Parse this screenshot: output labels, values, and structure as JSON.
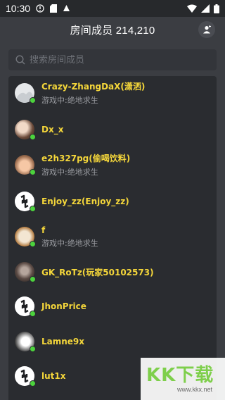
{
  "status_bar": {
    "time": "10:30",
    "icons_left": [
      "alert-icon",
      "sd-card-icon",
      "notification-icon"
    ],
    "icons_right": [
      "wifi-icon",
      "signal-icon",
      "battery-icon"
    ]
  },
  "header": {
    "title": "房间成员 214,210",
    "action_icon": "user-icon"
  },
  "search": {
    "placeholder": "搜索房间成员",
    "value": ""
  },
  "members": [
    {
      "name": "Crazy-ZhangDaX(潇洒)",
      "status": "游戏中:绝地求生",
      "avatar": "white",
      "online": true
    },
    {
      "name": "Dx_x",
      "status": "",
      "avatar": "warm",
      "online": true
    },
    {
      "name": "e2h327pg(偷喝饮料)",
      "status": "游戏中:绝地求生",
      "avatar": "peach",
      "online": true
    },
    {
      "name": "Enjoy_zz(Enjoy_zz)",
      "status": "",
      "avatar": "logo",
      "online": true
    },
    {
      "name": "f",
      "status": "游戏中:绝地求生",
      "avatar": "sepia",
      "online": true
    },
    {
      "name": "GK_RoTz(玩家50102573)",
      "status": "",
      "avatar": "dark",
      "online": true
    },
    {
      "name": "JhonPrice",
      "status": "",
      "avatar": "logo",
      "online": true
    },
    {
      "name": "Lamne9x",
      "status": "",
      "avatar": "ink",
      "online": true
    },
    {
      "name": "lut1x",
      "status": "",
      "avatar": "logo",
      "online": true
    }
  ],
  "watermark": {
    "logo_text": "KK下载",
    "url": "www.kkx.net"
  },
  "colors": {
    "background": "#3b3d42",
    "list_background": "#2a2c30",
    "name_color": "#f4d63a",
    "online_dot": "#4cd33d"
  }
}
